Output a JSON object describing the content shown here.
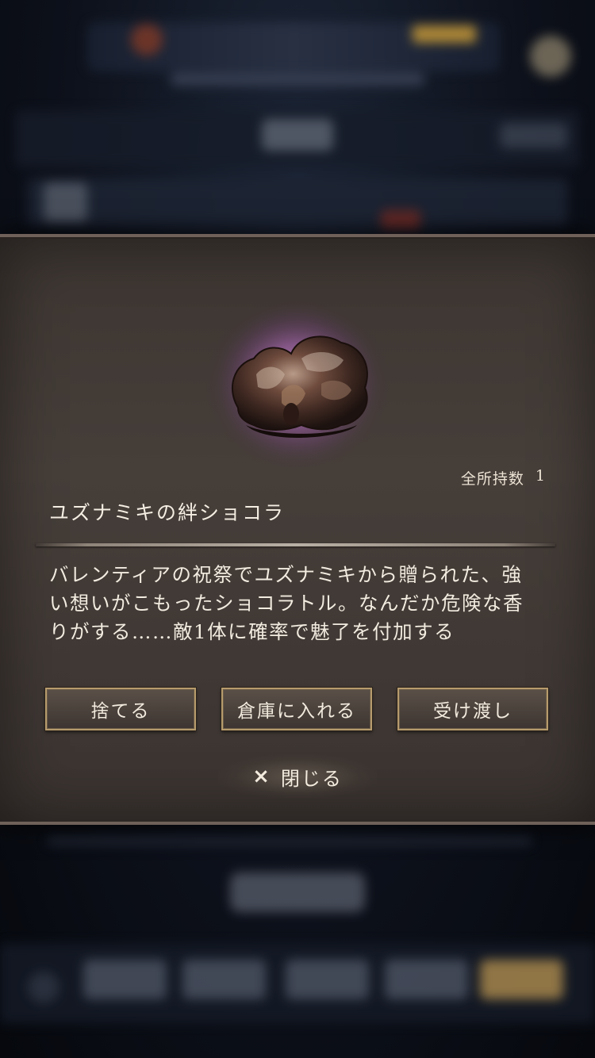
{
  "item": {
    "owned_label": "全所持数",
    "owned_count": "1",
    "name": "ユズナミキの絆ショコラ",
    "description_lines": [
      "バレンティアの祝祭でユズナミキから贈られた、強",
      "い想いがこもったショコラトル。なんだか危険な香",
      "りがする……敵1体に確率で魅了を付加する"
    ],
    "icon": "chocolate-item-icon",
    "glow_color": "#c07ad0"
  },
  "actions": {
    "discard": "捨てる",
    "store": "倉庫に入れる",
    "transfer": "受け渡し"
  },
  "close": {
    "icon": "×",
    "label": "閉じる"
  }
}
